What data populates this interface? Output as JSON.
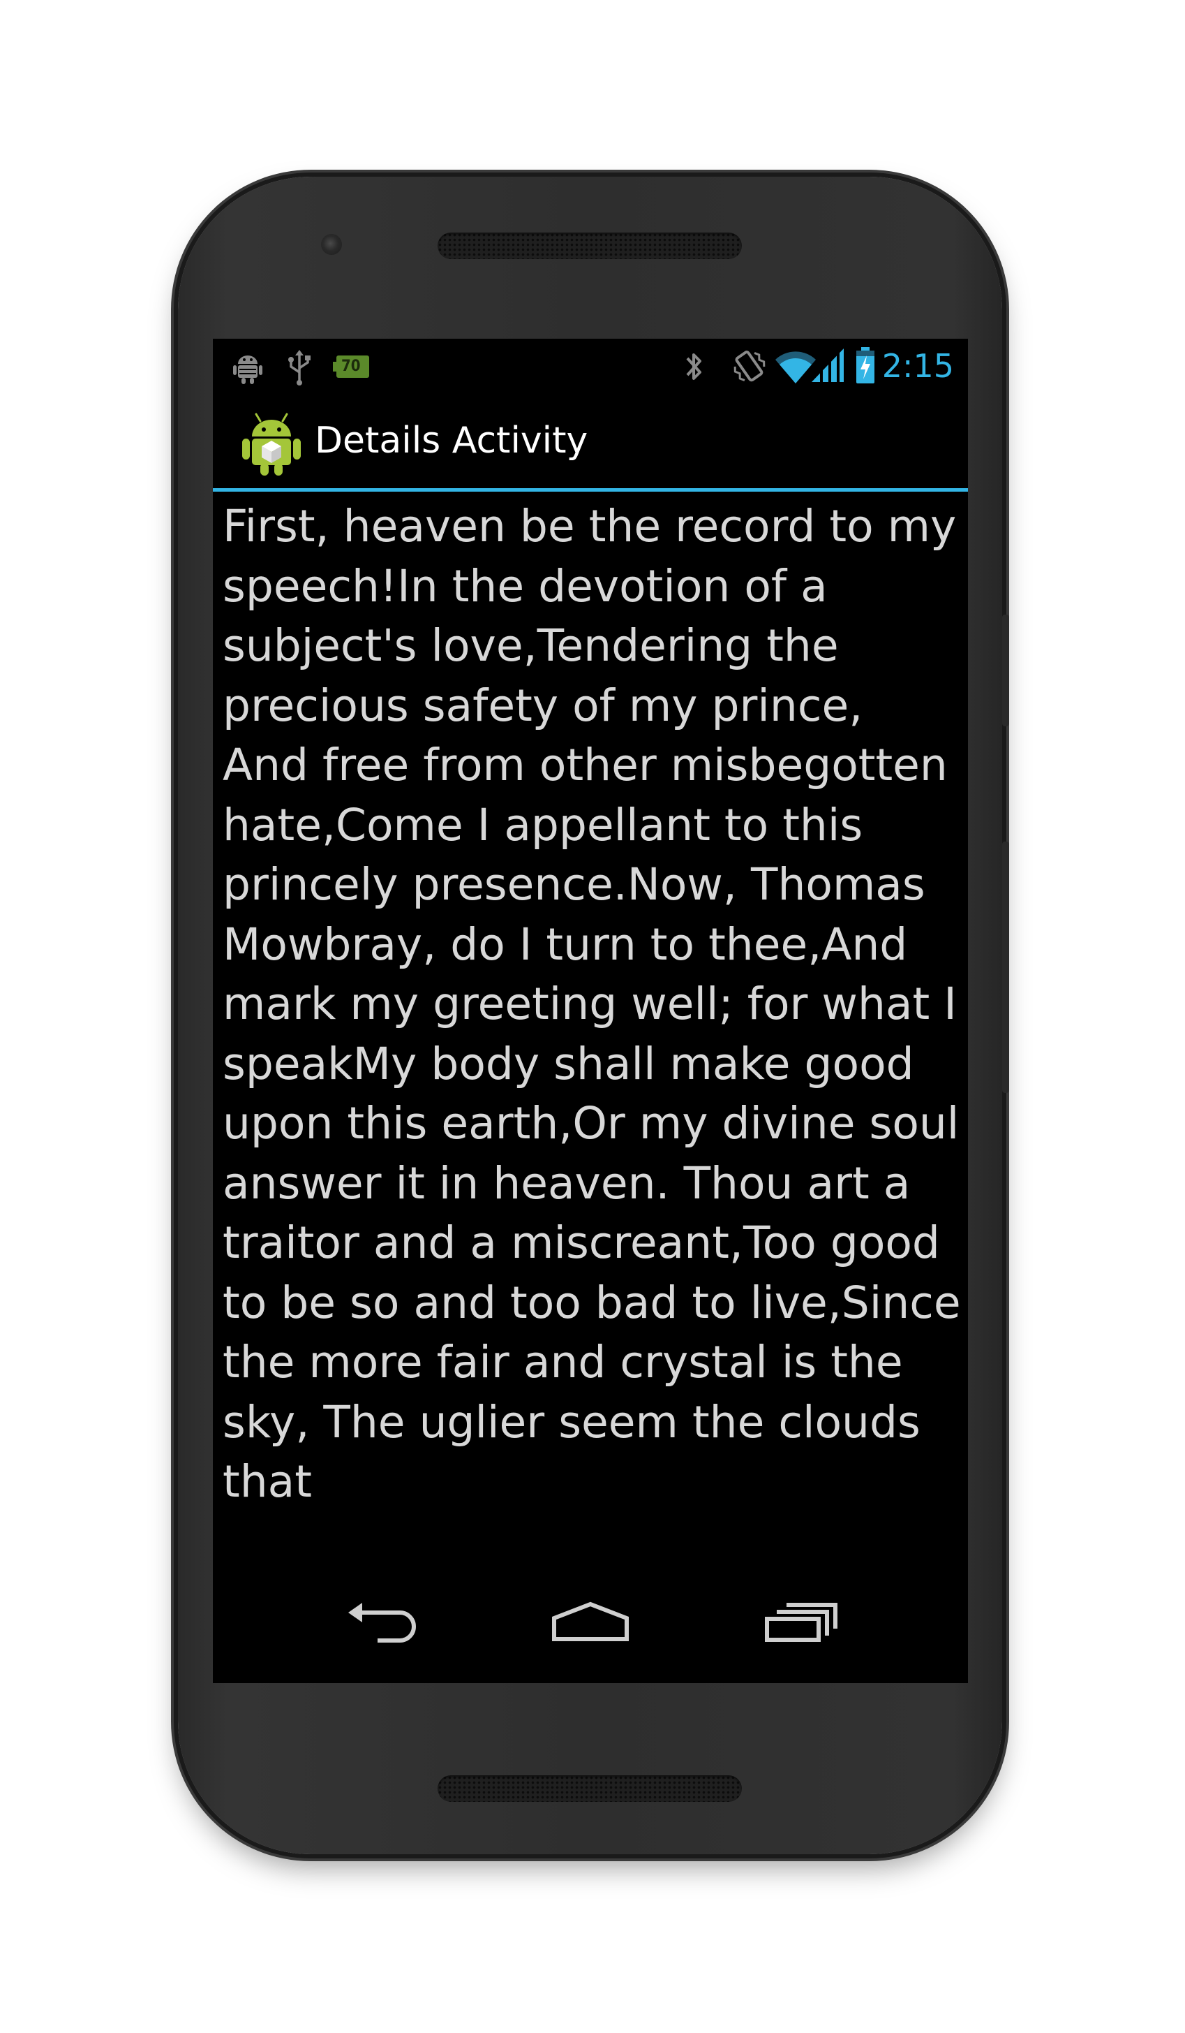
{
  "status_bar": {
    "time": "2:15",
    "battery_notification_level": "70",
    "icons": [
      "android-debug-icon",
      "usb-icon",
      "battery-notification-icon",
      "bluetooth-icon",
      "vibrate-icon",
      "wifi-icon",
      "cell-signal-icon",
      "battery-charging-icon"
    ],
    "accent_color": "#33b5e5"
  },
  "action_bar": {
    "icon": "android-app-icon",
    "title": "Details Activity",
    "divider_color": "#33b5e5"
  },
  "content": {
    "text": "First, heaven be the record to my speech!In the devotion of a subject's love,Tendering the precious safety of my prince, And free from other misbegotten hate,Come I appellant to this princely presence.Now, Thomas Mowbray, do I turn to thee,And mark my greeting well; for what I speakMy body shall make good upon this earth,Or my divine soul answer it in heaven. Thou art a traitor and a miscreant,Too good to be so and too bad to live,Since the more fair and crystal is the sky, The uglier seem the clouds that"
  },
  "nav_bar": {
    "buttons": [
      {
        "icon": "back-icon"
      },
      {
        "icon": "home-icon"
      },
      {
        "icon": "recents-icon"
      }
    ]
  }
}
